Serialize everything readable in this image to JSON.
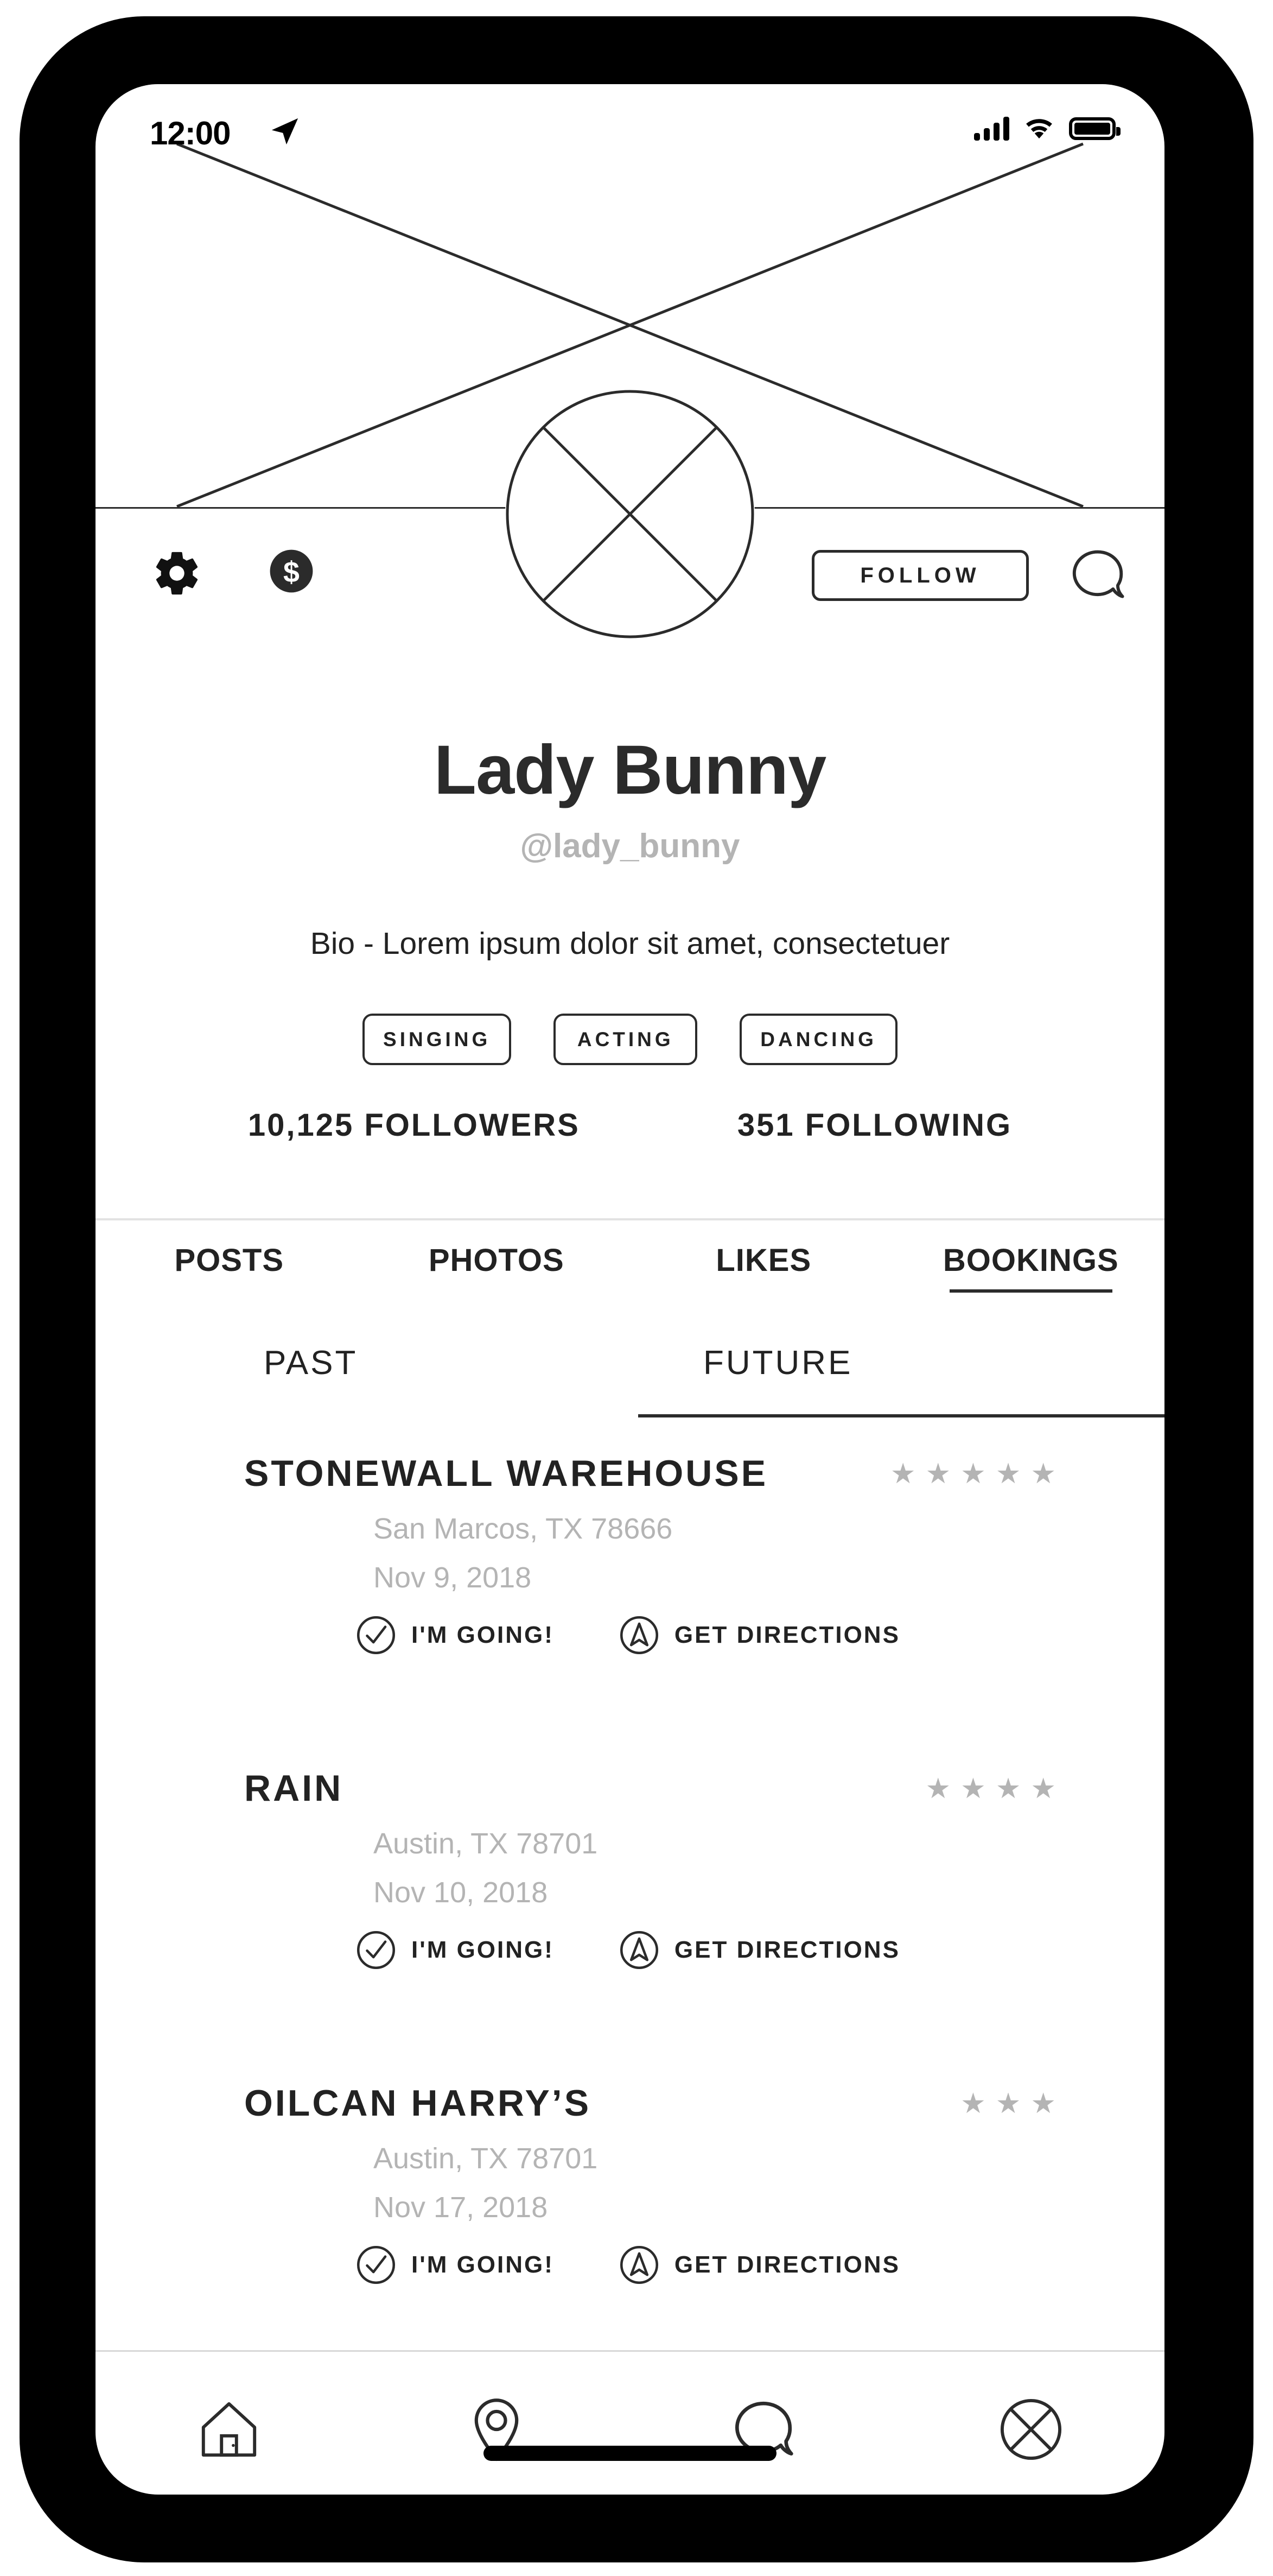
{
  "status_bar": {
    "time": "12:00",
    "location_icon": "location-arrow-icon",
    "signal_icon": "cellular-signal-icon",
    "wifi_icon": "wifi-icon",
    "battery_icon": "battery-full-icon"
  },
  "header": {
    "cover_placeholder": "image-placeholder-x",
    "avatar_placeholder": "avatar-placeholder-x",
    "settings_icon": "gear-icon",
    "money_icon": "dollar-circle-icon",
    "message_icon": "speech-bubble-icon",
    "follow_label": "FOLLOW"
  },
  "profile": {
    "name": "Lady Bunny",
    "handle": "@lady_bunny",
    "bio": "Bio - Lorem ipsum dolor sit amet, consectetuer",
    "tags": [
      "SINGING",
      "ACTING",
      "DANCING"
    ],
    "followers": "10,125 FOLLOWERS",
    "following": "351 FOLLOWING"
  },
  "tabs": [
    {
      "label": "POSTS",
      "active": false
    },
    {
      "label": "PHOTOS",
      "active": false
    },
    {
      "label": "LIKES",
      "active": false
    },
    {
      "label": "BOOKINGS",
      "active": true
    }
  ],
  "subtabs": [
    {
      "label": "PAST",
      "active": false
    },
    {
      "label": "FUTURE",
      "active": true
    }
  ],
  "booking_actions": {
    "going_label": "I'M GOING!",
    "going_icon": "check-circle-icon",
    "directions_label": "GET DIRECTIONS",
    "directions_icon": "navigation-arrow-circle-icon"
  },
  "bookings": [
    {
      "venue": "STONEWALL WAREHOUSE",
      "location": "San Marcos, TX 78666",
      "date": "Nov 9, 2018",
      "rating": 5
    },
    {
      "venue": "RAIN",
      "location": "Austin, TX 78701",
      "date": "Nov 10, 2018",
      "rating": 4
    },
    {
      "venue": "OILCAN HARRY’S",
      "location": "Austin, TX 78701",
      "date": "Nov 17, 2018",
      "rating": 3
    }
  ],
  "bottom_nav": [
    {
      "icon": "home-icon"
    },
    {
      "icon": "map-pin-icon"
    },
    {
      "icon": "speech-bubble-icon"
    },
    {
      "icon": "profile-circle-x-icon"
    }
  ],
  "colors": {
    "text_dark": "#222222",
    "text_muted": "#b4b4b4",
    "line": "#2b2b2b",
    "frame": "#000000"
  }
}
